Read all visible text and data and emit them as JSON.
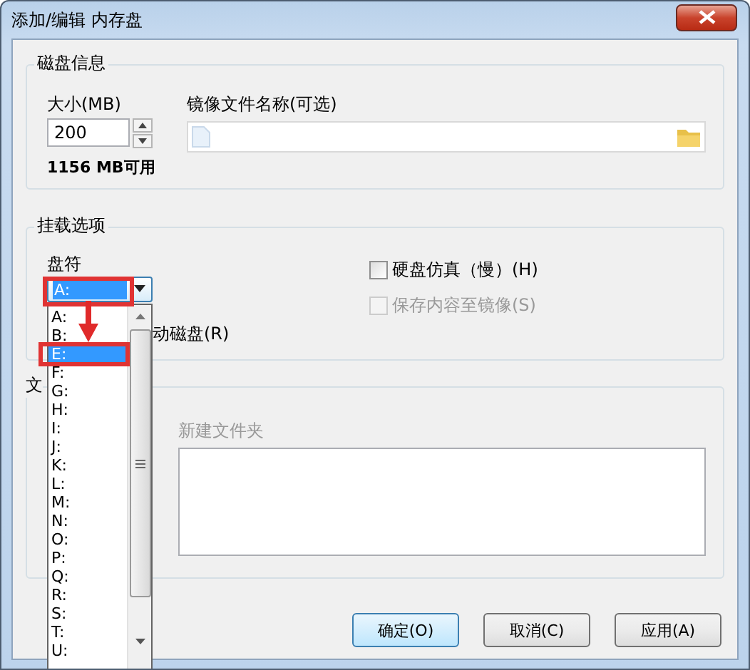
{
  "window": {
    "title": "添加/编辑 内存盘"
  },
  "disk_info": {
    "legend": "磁盘信息",
    "size_label": "大小(MB)",
    "size_value": "200",
    "image_label": "镜像文件名称(可选)",
    "available": "1156 MB可用"
  },
  "mount_options": {
    "legend": "挂载选项",
    "drive_label": "盘符",
    "drive_value": "A:",
    "removable_label": "动磁盘(R)",
    "checkboxes": [
      {
        "label": "硬盘仿真（慢）(H)",
        "checked": false,
        "disabled": false
      },
      {
        "label": "保存内容至镜像(S)",
        "checked": false,
        "disabled": true
      }
    ]
  },
  "folder_group": {
    "legend": "文",
    "folder_label": "新建文件夹"
  },
  "dropdown": {
    "items": [
      {
        "label": "A:",
        "selected": false
      },
      {
        "label": "B:",
        "selected": false
      },
      {
        "label": "E:",
        "selected": true
      },
      {
        "label": "F:",
        "selected": false
      },
      {
        "label": "G:",
        "selected": false
      },
      {
        "label": "H:",
        "selected": false
      },
      {
        "label": "I:",
        "selected": false
      },
      {
        "label": "J:",
        "selected": false
      },
      {
        "label": "K:",
        "selected": false
      },
      {
        "label": "L:",
        "selected": false
      },
      {
        "label": "M:",
        "selected": false
      },
      {
        "label": "N:",
        "selected": false
      },
      {
        "label": "O:",
        "selected": false
      },
      {
        "label": "P:",
        "selected": false
      },
      {
        "label": "Q:",
        "selected": false
      },
      {
        "label": "R:",
        "selected": false
      },
      {
        "label": "S:",
        "selected": false
      },
      {
        "label": "T:",
        "selected": false
      },
      {
        "label": "U:",
        "selected": false
      }
    ]
  },
  "annotation": {
    "combo_box": true,
    "item_box": true,
    "arrow": true
  },
  "buttons": [
    {
      "label": "确定(O)",
      "default": true
    },
    {
      "label": "取消(C)",
      "default": false
    },
    {
      "label": "应用(A)",
      "default": false
    }
  ]
}
